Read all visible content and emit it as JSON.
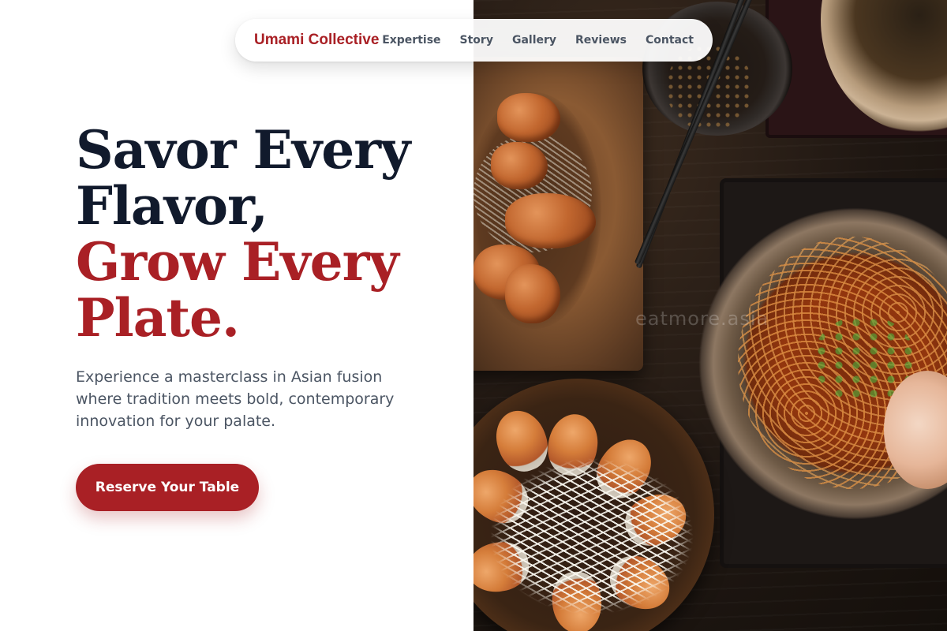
{
  "nav": {
    "brand": "Umami Collective",
    "links": [
      "Expertise",
      "Story",
      "Gallery",
      "Reviews",
      "Contact"
    ]
  },
  "hero": {
    "title_line1": "Savor Every",
    "title_line2": "Flavor,",
    "title_accent_line1": "Grow Every",
    "title_accent_line2": "Plate.",
    "subtitle": "Experience a masterclass in Asian fusion where tradition meets bold, contemporary innovation for your palate.",
    "cta_label": "Reserve Your Table"
  },
  "photo": {
    "watermark": "eatmore.asia"
  },
  "colors": {
    "accent": "#a92025",
    "heading": "#111a2c",
    "body_text": "#4b5563",
    "background": "#ffffff"
  }
}
